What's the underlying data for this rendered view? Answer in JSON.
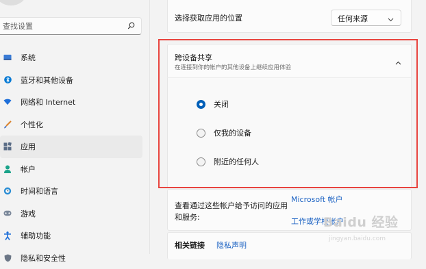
{
  "search": {
    "placeholder": "查找设置"
  },
  "sidebar": {
    "items": [
      {
        "label": "系统",
        "icon": "monitor-icon"
      },
      {
        "label": "蓝牙和其他设备",
        "icon": "bluetooth-icon"
      },
      {
        "label": "网络和 Internet",
        "icon": "wifi-icon"
      },
      {
        "label": "个性化",
        "icon": "brush-icon"
      },
      {
        "label": "应用",
        "icon": "apps-icon",
        "active": true
      },
      {
        "label": "帐户",
        "icon": "person-icon"
      },
      {
        "label": "时间和语言",
        "icon": "globe-clock-icon"
      },
      {
        "label": "游戏",
        "icon": "gamepad-icon"
      },
      {
        "label": "辅助功能",
        "icon": "accessibility-icon"
      },
      {
        "label": "隐私和安全性",
        "icon": "shield-icon"
      }
    ]
  },
  "source": {
    "label": "选择获取应用的位置",
    "value": "任何来源"
  },
  "share": {
    "title": "跨设备共享",
    "subtitle": "在连接到你的帐户的其他设备上继续应用体验",
    "options": [
      {
        "label": "关闭",
        "selected": true
      },
      {
        "label": "仅我的设备",
        "selected": false
      },
      {
        "label": "附近的任何人",
        "selected": false
      }
    ]
  },
  "accounts": {
    "description": "查看通过这些帐户给予访问的应用和服务:",
    "link1": "Microsoft 帐户",
    "link2": "工作或学校帐户"
  },
  "related": {
    "title": "相关链接",
    "privacy_link": "隐私声明"
  },
  "watermark": {
    "text": "Baidu 经验",
    "sub": "jingyan.baidu.com"
  },
  "colors": {
    "accent": "#005fb8",
    "link": "#1b62c3",
    "highlight": "#e8443f"
  }
}
